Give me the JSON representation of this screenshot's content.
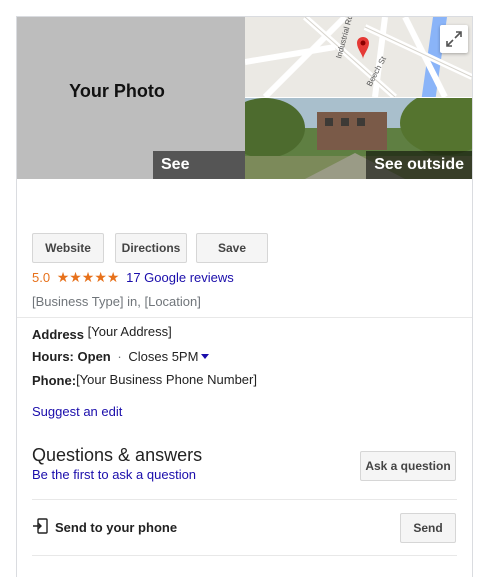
{
  "photos": {
    "main_label": "Your Photo",
    "see_photos": "See photos",
    "see_outside": "See outside",
    "map_labels": [
      "Industrial Rd",
      "Beech St"
    ]
  },
  "actions": {
    "website": "Website",
    "directions": "Directions",
    "save": "Save"
  },
  "rating": {
    "score": "5.0",
    "stars": "★★★★★",
    "reviews": "17 Google reviews"
  },
  "business_type": "[Business Type] in, [Location]",
  "details": {
    "address_label": "Address",
    "address_value": "[Your Address]",
    "hours_label": "Hours:",
    "hours_status": "Open",
    "hours_separator": "·",
    "hours_close": "Closes 5PM",
    "phone_label": "Phone:",
    "phone_value": "[Your Business Phone Number]"
  },
  "suggest_edit": "Suggest an edit",
  "qa": {
    "title": "Questions & answers",
    "subtitle": "Be the first to ask a question",
    "ask_button": "Ask a question"
  },
  "send": {
    "label": "Send to your phone",
    "button": "Send"
  },
  "colors": {
    "star": "#e7711b",
    "link": "#1a0dab",
    "map_pin": "#e53935"
  }
}
